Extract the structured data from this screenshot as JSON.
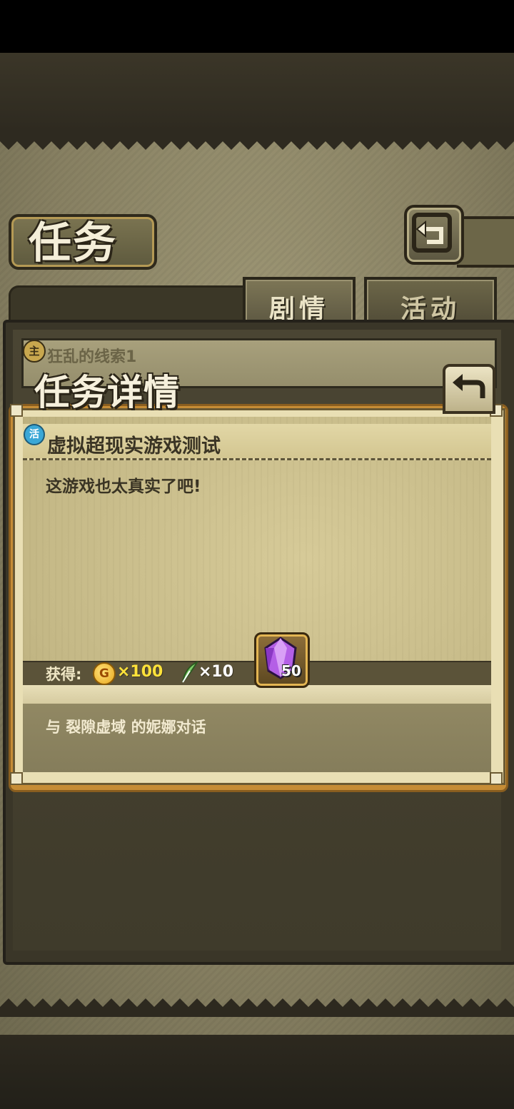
{
  "header": {
    "title": "任务",
    "back_icon": "back-arrow-icon"
  },
  "tabs": [
    {
      "label": "剧情",
      "active": true
    },
    {
      "label": "活动",
      "active": false
    }
  ],
  "quest_list": [
    {
      "badge": "主",
      "title": "狂乱的线索1"
    }
  ],
  "detail": {
    "title": "任务详情",
    "mission_badge": "活",
    "mission_name": "虚拟超现实游戏测试",
    "description": "这游戏也太真实了吧!",
    "reward_label": "获得:",
    "rewards": {
      "coin_icon_text": "G",
      "coin_amount": "×100",
      "feather_amount": "×10",
      "gem_count": "50"
    },
    "objective": "与 裂隙虚域 的妮娜对话"
  },
  "colors": {
    "parchment": "#878062",
    "modal_frame": "#c68d36",
    "coin_text": "#ffe23a",
    "gem": "#a64fd8"
  }
}
